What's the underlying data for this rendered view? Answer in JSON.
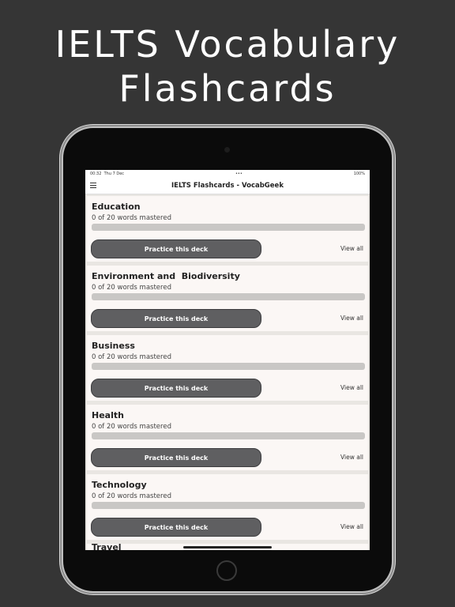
{
  "hero": {
    "line1": "IELTS Vocabulary",
    "line2": "Flashcards"
  },
  "status": {
    "time": "00:32",
    "date": "Thu 7 Dec",
    "dots": "•••",
    "battery": "100%"
  },
  "nav": {
    "title": "IELTS Flashcards - VocabGeek",
    "menu_icon": "hamburger-icon"
  },
  "decks": [
    {
      "title": "Education",
      "progress_text": "0 of 20 words mastered",
      "progress": 0,
      "button": "Practice this deck",
      "view_all": "View all"
    },
    {
      "title": "Environment and  Biodiversity",
      "progress_text": "0 of 20 words mastered",
      "progress": 0,
      "button": "Practice this deck",
      "view_all": "View all"
    },
    {
      "title": "Business",
      "progress_text": "0 of 20 words mastered",
      "progress": 0,
      "button": "Practice this deck",
      "view_all": "View all"
    },
    {
      "title": "Health",
      "progress_text": "0 of 20 words mastered",
      "progress": 0,
      "button": "Practice this deck",
      "view_all": "View all"
    },
    {
      "title": "Technology",
      "progress_text": "0 of 20 words mastered",
      "progress": 0,
      "button": "Practice this deck",
      "view_all": "View all"
    }
  ],
  "partial_deck": {
    "title": "Travel"
  },
  "colors": {
    "background": "#353535",
    "card": "#fbf7f5",
    "button": "#5f5f61",
    "track": "#c9c7c5"
  }
}
